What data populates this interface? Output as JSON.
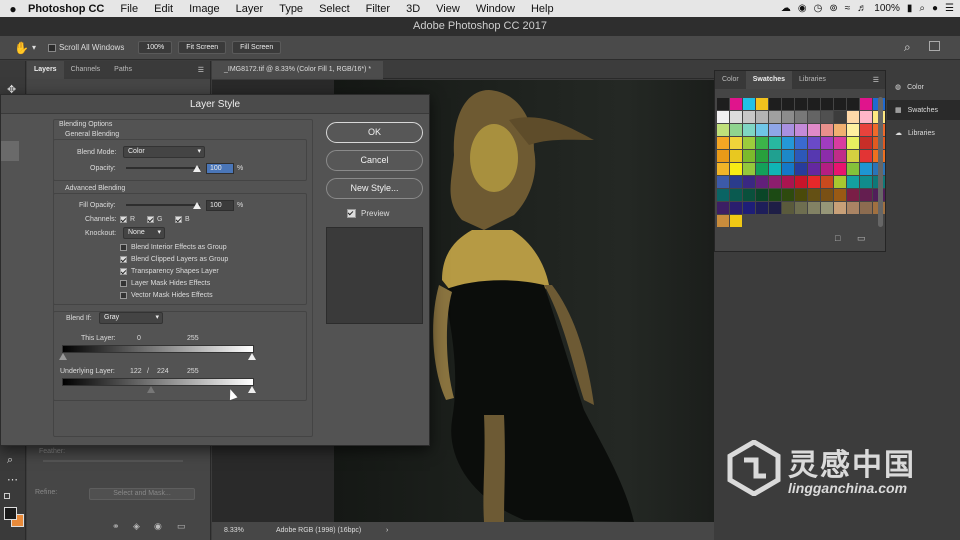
{
  "menubar": {
    "app": "Photoshop CC",
    "items": [
      "File",
      "Edit",
      "Image",
      "Layer",
      "Type",
      "Select",
      "Filter",
      "3D",
      "View",
      "Window",
      "Help"
    ],
    "battery": "100%"
  },
  "window": {
    "title": "Adobe Photoshop CC 2017"
  },
  "options": {
    "scroll_all": "Scroll All Windows",
    "zoom100": "100%",
    "fit_screen": "Fit Screen",
    "fill_screen": "Fill Screen"
  },
  "left_panel": {
    "tabs": [
      "Layers",
      "Channels",
      "Paths"
    ],
    "feather": "Feather:",
    "refine": "Refine:",
    "select_mask": "Select and Mask..."
  },
  "document": {
    "tab": "_IMG8172.tif @ 8.33% (Color Fill 1, RGB/16*) *",
    "zoom": "8.33%",
    "profile": "Adobe RGB (1998) (16bpc)"
  },
  "swatches": {
    "tabs": [
      "Color",
      "Swatches",
      "Libraries"
    ],
    "colors": [
      "#1e1e1e",
      "#e0148c",
      "#21c0e6",
      "#f2c21d",
      "#1e1e1e",
      "#1e1e1e",
      "#1e1e1e",
      "#1e1e1e",
      "#1e1e1e",
      "#1e1e1e",
      "#1e1e1e",
      "#e0148c",
      "#1e6ad2",
      "#f2f2f2",
      "#dcdcdc",
      "#c8c8c8",
      "#b4b4b4",
      "#a0a0a0",
      "#8c8c8c",
      "#787878",
      "#646464",
      "#505050",
      "#3c3c3c",
      "#ffd8a8",
      "#ffb6c8",
      "#ffe880",
      "#bfe07a",
      "#8fd48f",
      "#7fd6c4",
      "#6fc6e8",
      "#8fa6e8",
      "#a890e0",
      "#c48ad8",
      "#e08ac8",
      "#e8908c",
      "#f0b070",
      "#fff0a0",
      "#e8423c",
      "#f06a2a",
      "#f5a623",
      "#f0d43a",
      "#9ccc3c",
      "#3cb44a",
      "#28b8a0",
      "#2498d8",
      "#3a6ad0",
      "#6a4ac8",
      "#a03cc0",
      "#d83ca0",
      "#e8f060",
      "#c82e28",
      "#e05a20",
      "#e89a18",
      "#e8c820",
      "#7cba2c",
      "#28a03c",
      "#20a090",
      "#1c88c8",
      "#2c58b8",
      "#5638b0",
      "#8c2caa",
      "#c02c88",
      "#d4d040",
      "#e23434",
      "#ee7020",
      "#f0b428",
      "#f7ec14",
      "#94c83c",
      "#14a05a",
      "#10b4b4",
      "#1478c8",
      "#283c9c",
      "#6428a0",
      "#b41e82",
      "#e8146e",
      "#84c23a",
      "#1e96d2",
      "#2a74b8",
      "#3c5aa8",
      "#2a3c8c",
      "#3a2882",
      "#62207a",
      "#8c1e6e",
      "#aa1450",
      "#c8142a",
      "#e6282a",
      "#c84a1e",
      "#a8c830",
      "#14a0a0",
      "#108c8c",
      "#0e7878",
      "#0a6464",
      "#0a5a50",
      "#0a503c",
      "#0a4628",
      "#1c4a14",
      "#2e4a0e",
      "#4a4a0a",
      "#645014",
      "#7a5014",
      "#9a5a14",
      "#7a1e46",
      "#641e50",
      "#501e5a",
      "#3c1e64",
      "#2a1e6e",
      "#1e1e78",
      "#1e1e5a",
      "#1e1e46",
      "#5a5a3c",
      "#6e6e50",
      "#828264",
      "#969678",
      "#c8a078",
      "#aa8464",
      "#8c6c50",
      "#a07040",
      "#c88c3c",
      "#f0c814"
    ]
  },
  "right_panel": {
    "items": [
      "Color",
      "Swatches",
      "Libraries"
    ]
  },
  "dialog": {
    "title": "Layer Style",
    "blending_options": "Blending Options",
    "general_blending": "General Blending",
    "blend_mode_label": "Blend Mode:",
    "blend_mode": "Color",
    "opacity_label": "Opacity:",
    "opacity": "100",
    "percent": "%",
    "advanced_blending": "Advanced Blending",
    "fill_opacity_label": "Fill Opacity:",
    "fill_opacity": "100",
    "channels_label": "Channels:",
    "ch_r": "R",
    "ch_g": "G",
    "ch_b": "B",
    "knockout_label": "Knockout:",
    "knockout": "None",
    "opt1": "Blend Interior Effects as Group",
    "opt2": "Blend Clipped Layers as Group",
    "opt3": "Transparency Shapes Layer",
    "opt4": "Layer Mask Hides Effects",
    "opt5": "Vector Mask Hides Effects",
    "blend_if_label": "Blend If:",
    "blend_if": "Gray",
    "this_layer": "This Layer:",
    "this_min": "0",
    "this_max": "255",
    "underlying": "Underlying Layer:",
    "under_a": "122",
    "under_slash": "/",
    "under_b": "224",
    "under_max": "255",
    "ok": "OK",
    "cancel": "Cancel",
    "new_style": "New Style...",
    "preview": "Preview"
  },
  "watermark": {
    "cn": "灵感中国",
    "en": "lingganchina.com"
  }
}
